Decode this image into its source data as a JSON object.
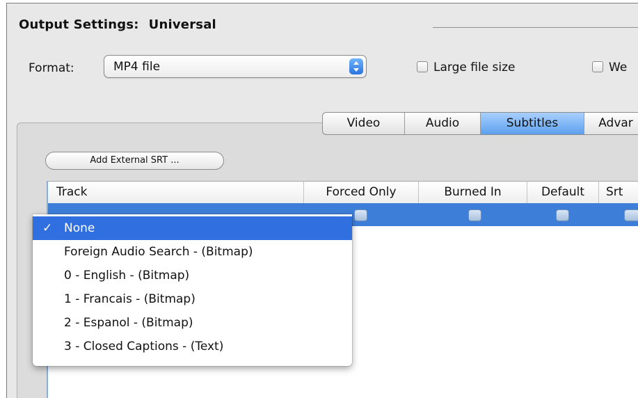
{
  "header": {
    "label": "Output Settings:",
    "value": "Universal"
  },
  "format": {
    "label": "Format:",
    "selected": "MP4 file"
  },
  "options": {
    "large_file": "Large file size",
    "web_optimized": "We"
  },
  "tabs": [
    {
      "label": "Video",
      "selected": false
    },
    {
      "label": "Audio",
      "selected": false
    },
    {
      "label": "Subtitles",
      "selected": true
    },
    {
      "label": "Advar",
      "selected": false
    }
  ],
  "add_button": "Add External SRT ...",
  "table": {
    "columns": [
      "Track",
      "Forced Only",
      "Burned In",
      "Default",
      "Srt"
    ]
  },
  "menu": {
    "check": "✓",
    "items": [
      "None",
      "Foreign Audio Search - (Bitmap)",
      "0 - English - (Bitmap)",
      "1 - Francais - (Bitmap)",
      "2 - Espanol - (Bitmap)",
      "3 - Closed Captions - (Text)"
    ]
  }
}
